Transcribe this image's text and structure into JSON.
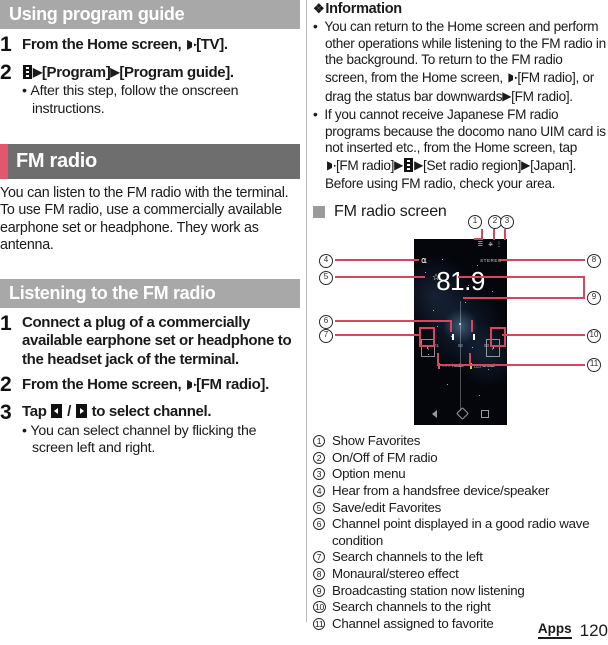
{
  "left": {
    "section_heading": "Using program guide",
    "steps_guide": [
      {
        "num": "1",
        "title_pre": "From the Home screen, ",
        "title_post": "[TV].",
        "bullets": []
      },
      {
        "num": "2",
        "title_pre": "",
        "title_post": "[Program]",
        "title_tail": "[Program guide].",
        "bullets": [
          "After this step, follow the onscreen instructions."
        ]
      }
    ],
    "chapter_heading": "FM radio",
    "intro_paragraph": "You can listen to the FM radio with the terminal. To use FM radio, use a commercially available earphone set or headphone. They work as antenna.",
    "listening_heading": "Listening to the FM radio",
    "steps_listen": [
      {
        "num": "1",
        "title": "Connect a plug of a commercially available earphone set or headphone to the headset jack of the terminal.",
        "bullets": []
      },
      {
        "num": "2",
        "title_pre": "From the Home screen, ",
        "title_post": "[FM radio].",
        "bullets": []
      },
      {
        "num": "3",
        "title_pre": "Tap ",
        "title_mid": " / ",
        "title_post": " to select channel.",
        "bullets": [
          "You can select channel by flicking the screen left and right."
        ]
      }
    ]
  },
  "right": {
    "information_title": "Information",
    "information_bullets": [
      {
        "parts": [
          "You can return to the Home screen and perform other operations while listening to the FM radio in the background. To return to the FM radio screen, from the Home screen, ",
          "[FM radio], or drag the status bar downwards",
          "[FM radio]."
        ]
      },
      {
        "parts": [
          "If you cannot receive Japanese FM radio programs because the docomo nano UIM card is not inserted etc., from the Home screen, tap ",
          "[FM radio]",
          "[Set radio region]",
          "[Japan]. Before using FM radio, check your area."
        ]
      }
    ],
    "sub_heading": "FM radio screen",
    "phone": {
      "frequency": "81.9",
      "stereo_label": "STEREO",
      "scale_labels": [
        "81",
        "82",
        "83"
      ],
      "prev_glyph": "‹",
      "next_glyph": "›",
      "favorites": [
        {
          "name": "○○○ Radio"
        },
        {
          "name": "△△ Broad"
        }
      ],
      "headphone_icon": "headphone-icon",
      "star_icon": "favorites-star-icon"
    },
    "callouts": [
      "1",
      "2",
      "3",
      "4",
      "5",
      "6",
      "7",
      "8",
      "9",
      "10",
      "11"
    ],
    "legend": [
      {
        "num": "1",
        "text": "Show Favorites"
      },
      {
        "num": "2",
        "text": "On/Off of FM radio"
      },
      {
        "num": "3",
        "text": "Option menu"
      },
      {
        "num": "4",
        "text": "Hear from a handsfree device/speaker"
      },
      {
        "num": "5",
        "text": "Save/edit Favorites"
      },
      {
        "num": "6",
        "text": "Channel point displayed in a good radio wave condition"
      },
      {
        "num": "7",
        "text": "Search channels to the left"
      },
      {
        "num": "8",
        "text": "Monaural/stereo effect"
      },
      {
        "num": "9",
        "text": "Broadcasting station now listening"
      },
      {
        "num": "10",
        "text": "Search channels to the right"
      },
      {
        "num": "11",
        "text": "Channel assigned to favorite"
      }
    ]
  },
  "footer": {
    "tag": "Apps",
    "page_number": "120"
  },
  "colors": {
    "accent_red": "#e2566e",
    "leader_red": "#d8465e",
    "section_gray": "#a8a8a8",
    "chapter_gray": "#6e6e6e"
  }
}
